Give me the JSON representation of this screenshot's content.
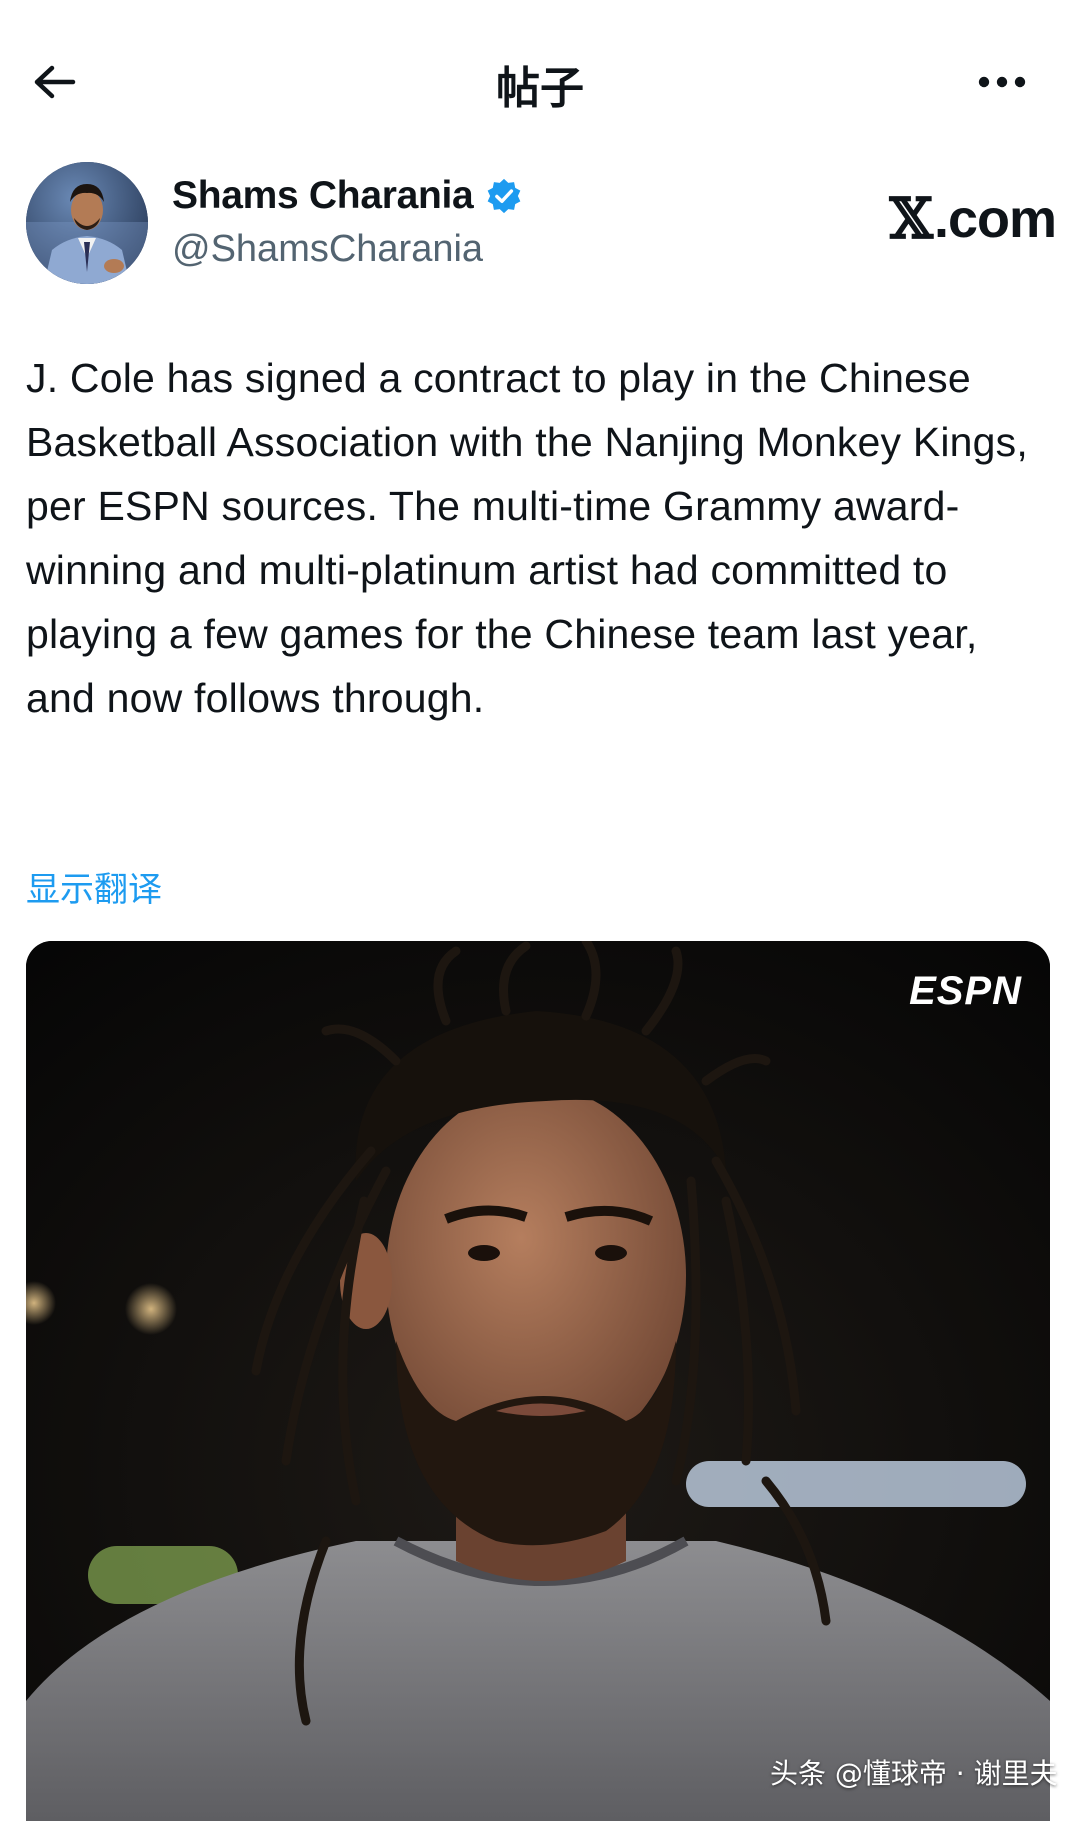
{
  "header": {
    "title": "帖子",
    "back_icon": "arrow-left-icon",
    "more_icon": "more-horizontal-icon"
  },
  "author": {
    "name": "Shams Charania",
    "handle": "@ShamsCharania",
    "verified": true,
    "verified_color": "#1d9bf0"
  },
  "brand": {
    "x_symbol": "𝕏",
    "domain": ".com"
  },
  "tweet": {
    "text": "J. Cole has signed a contract to play in the Chinese Basketball Association with the Nanjing Monkey Kings, per ESPN sources. The multi-time Grammy award-winning and multi-platinum artist had committed to playing a few games for the Chinese team last year, and now follows through.",
    "translate_label": "显示翻译"
  },
  "media": {
    "logo_text": "ESPN"
  },
  "watermark": "头条 @懂球帝 · 谢里夫",
  "colors": {
    "link": "#1d9bf0",
    "text": "#0f1419",
    "muted": "#536471"
  }
}
